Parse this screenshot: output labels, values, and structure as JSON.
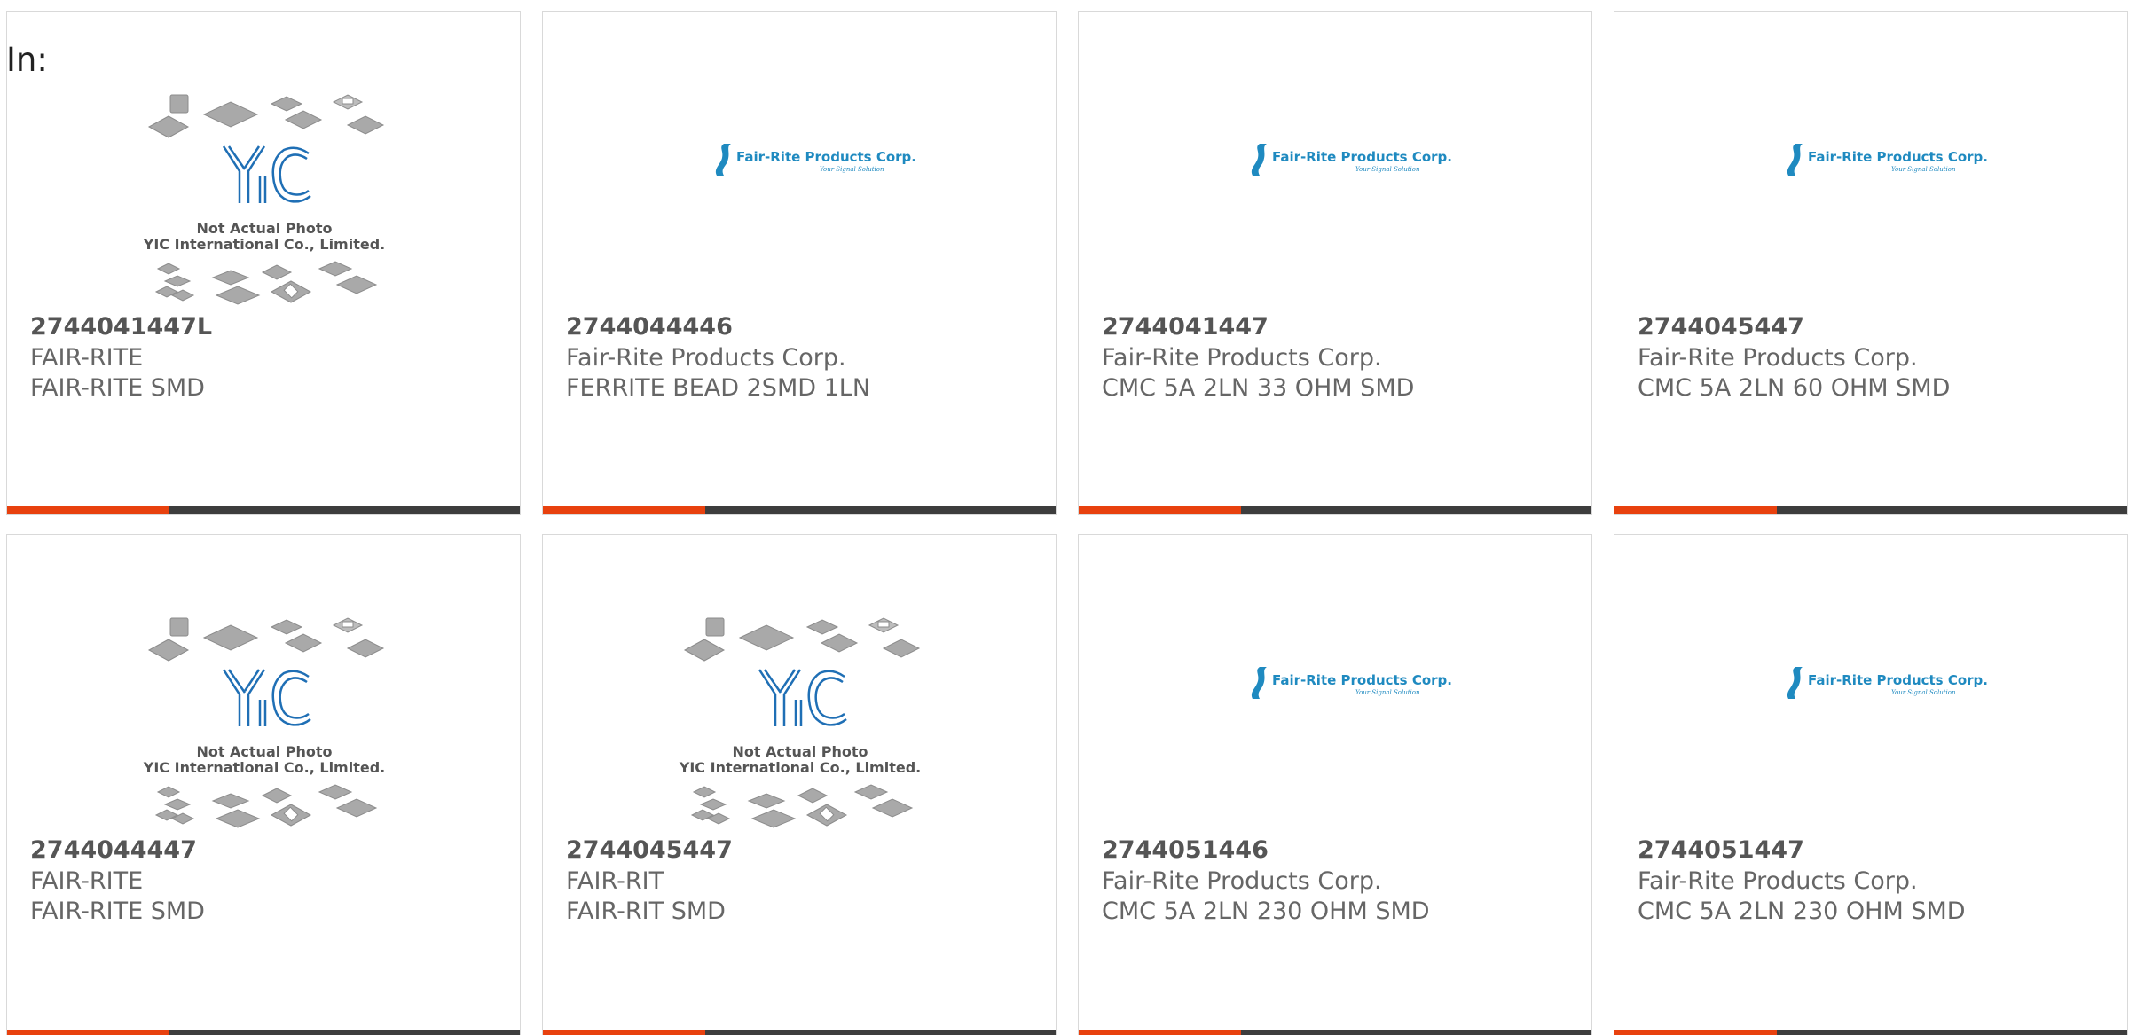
{
  "header": {
    "label": "In:"
  },
  "placeholder": {
    "line1": "Not Actual Photo",
    "line2": "YIC International Co., Limited."
  },
  "fair_rite_logo": {
    "name": "Fair-Rite Products Corp.",
    "tagline": "Your Signal Solution"
  },
  "colors": {
    "accent": "#e8410e",
    "bar": "#3d3d3d",
    "logo_blue": "#1f8ac0"
  },
  "products": [
    {
      "part": "2744041447L",
      "manufacturer": "FAIR-RITE",
      "description": "FAIR-RITE SMD",
      "image": "yic-placeholder"
    },
    {
      "part": "2744044446",
      "manufacturer": "Fair-Rite Products Corp.",
      "description": "FERRITE BEAD 2SMD 1LN",
      "image": "fair-rite-logo"
    },
    {
      "part": "2744041447",
      "manufacturer": "Fair-Rite Products Corp.",
      "description": "CMC 5A 2LN 33 OHM SMD",
      "image": "fair-rite-logo"
    },
    {
      "part": "2744045447",
      "manufacturer": "Fair-Rite Products Corp.",
      "description": "CMC 5A 2LN 60 OHM SMD",
      "image": "fair-rite-logo"
    },
    {
      "part": "2744044447",
      "manufacturer": "FAIR-RITE",
      "description": "FAIR-RITE SMD",
      "image": "yic-placeholder"
    },
    {
      "part": "2744045447",
      "manufacturer": "FAIR-RIT",
      "description": "FAIR-RIT SMD",
      "image": "yic-placeholder"
    },
    {
      "part": "2744051446",
      "manufacturer": "Fair-Rite Products Corp.",
      "description": "CMC 5A 2LN 230 OHM SMD",
      "image": "fair-rite-logo"
    },
    {
      "part": "2744051447",
      "manufacturer": "Fair-Rite Products Corp.",
      "description": "CMC 5A 2LN 230 OHM SMD",
      "image": "fair-rite-logo"
    }
  ]
}
